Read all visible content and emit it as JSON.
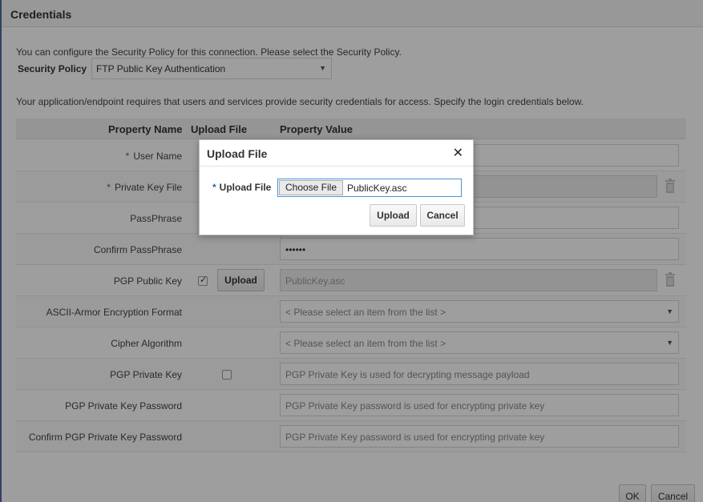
{
  "window": {
    "title": "Credentials"
  },
  "intro_text": "You can configure the Security Policy for this connection. Please select the Security Policy.",
  "security_policy": {
    "label": "Security Policy",
    "value": "FTP Public Key Authentication"
  },
  "credentials_note": "Your application/endpoint requires that users and services provide security credentials for access. Specify the login credentials below.",
  "table": {
    "headers": {
      "property_name": "Property Name",
      "upload_file": "Upload File",
      "property_value": "Property Value"
    },
    "rows": [
      {
        "label": "User Name",
        "required": true,
        "value": ""
      },
      {
        "label": "Private Key File",
        "required": true,
        "value": ""
      },
      {
        "label": "PassPhrase",
        "required": false,
        "value": ""
      },
      {
        "label": "Confirm PassPhrase",
        "required": false,
        "value": "••••••"
      },
      {
        "label": "PGP Public Key",
        "required": false,
        "checked": true,
        "button": "Upload",
        "value": "PublicKey.asc"
      },
      {
        "label": "ASCII-Armor Encryption Format",
        "required": false,
        "value": "< Please select an item from the list >"
      },
      {
        "label": "Cipher Algorithm",
        "required": false,
        "value": "< Please select an item from the list >"
      },
      {
        "label": "PGP Private Key",
        "required": false,
        "checked": false,
        "value": "PGP Private Key is used for decrypting message payload"
      },
      {
        "label": "PGP Private Key Password",
        "required": false,
        "value": "PGP Private Key  password is used for encrypting private key"
      },
      {
        "label": "Confirm PGP Private Key Password",
        "required": false,
        "value": "PGP Private Key  password is used for encrypting private key"
      }
    ],
    "required_marker": "*"
  },
  "footer": {
    "ok": "OK",
    "cancel": "Cancel"
  },
  "dialog": {
    "title": "Upload File",
    "close": "✕",
    "field_label": "Upload File",
    "choose_file": "Choose File",
    "file_name": "PublicKey.asc",
    "upload": "Upload",
    "cancel": "Cancel"
  },
  "colors": {
    "required_marker": "#1a6dbf",
    "focus_border": "#4a90d9",
    "overlay": "rgba(0,0,0,0.38)"
  }
}
